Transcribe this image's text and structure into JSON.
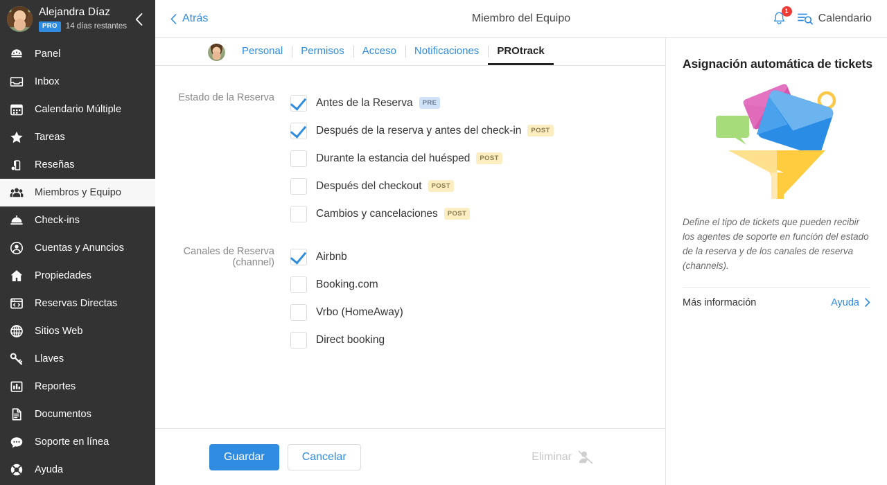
{
  "sidebar": {
    "user": {
      "name": "Alejandra Díaz",
      "plan_badge": "PRO",
      "trial": "14 días restantes"
    },
    "collapse_icon": "chevron-left-icon",
    "items": [
      {
        "label": "Panel",
        "icon": "dashboard-icon",
        "active": false
      },
      {
        "label": "Inbox",
        "icon": "inbox-icon",
        "active": false
      },
      {
        "label": "Calendario Múltiple",
        "icon": "calendar-icon",
        "active": false
      },
      {
        "label": "Tareas",
        "icon": "star-icon",
        "active": false
      },
      {
        "label": "Reseñas",
        "icon": "review-icon",
        "active": false
      },
      {
        "label": "Miembros y Equipo",
        "icon": "users-icon",
        "active": true
      },
      {
        "label": "Check-ins",
        "icon": "bell-service-icon",
        "active": false
      },
      {
        "label": "Cuentas y Anuncios",
        "icon": "account-circle-icon",
        "active": false
      },
      {
        "label": "Propiedades",
        "icon": "home-icon",
        "active": false
      },
      {
        "label": "Reservas Directas",
        "icon": "code-window-icon",
        "active": false
      },
      {
        "label": "Sitios Web",
        "icon": "globe-icon",
        "active": false
      },
      {
        "label": "Llaves",
        "icon": "key-icon",
        "active": false
      },
      {
        "label": "Reportes",
        "icon": "bar-chart-icon",
        "active": false
      },
      {
        "label": "Documentos",
        "icon": "document-icon",
        "active": false
      },
      {
        "label": "Soporte en línea",
        "icon": "chat-icon",
        "active": false
      },
      {
        "label": "Ayuda",
        "icon": "lifebuoy-icon",
        "active": false
      }
    ]
  },
  "topbar": {
    "back_label": "Atrás",
    "title": "Miembro del Equipo",
    "notification_count": "1",
    "calendar_label": "Calendario"
  },
  "tabs": [
    {
      "label": "Personal",
      "active": false
    },
    {
      "label": "Permisos",
      "active": false
    },
    {
      "label": "Acceso",
      "active": false
    },
    {
      "label": "Notificaciones",
      "active": false
    },
    {
      "label": "PROtrack",
      "active": true
    }
  ],
  "form": {
    "groups": [
      {
        "label": "Estado de la Reserva",
        "options": [
          {
            "label": "Antes de la Reserva",
            "checked": true,
            "tag": "PRE",
            "tag_type": "pre"
          },
          {
            "label": "Después de la reserva y antes del check-in",
            "checked": true,
            "tag": "POST",
            "tag_type": "post"
          },
          {
            "label": "Durante la estancia del huésped",
            "checked": false,
            "tag": "POST",
            "tag_type": "post"
          },
          {
            "label": "Después del checkout",
            "checked": false,
            "tag": "POST",
            "tag_type": "post"
          },
          {
            "label": "Cambios y cancelaciones",
            "checked": false,
            "tag": "POST",
            "tag_type": "post"
          }
        ]
      },
      {
        "label": "Canales de Reserva (channel)",
        "options": [
          {
            "label": "Airbnb",
            "checked": true,
            "tag": "",
            "tag_type": ""
          },
          {
            "label": "Booking.com",
            "checked": false,
            "tag": "",
            "tag_type": ""
          },
          {
            "label": "Vrbo (HomeAway)",
            "checked": false,
            "tag": "",
            "tag_type": ""
          },
          {
            "label": "Direct booking",
            "checked": false,
            "tag": "",
            "tag_type": ""
          }
        ]
      }
    ]
  },
  "footer": {
    "save_label": "Guardar",
    "cancel_label": "Cancelar",
    "delete_label": "Eliminar",
    "delete_icon": "user-remove-icon"
  },
  "rightpanel": {
    "title": "Asignación automática de tickets",
    "illustration": "funnel-tickets-illustration",
    "description": "Define el tipo de tickets que pueden recibir los agentes de soporte en función del estado de la reserva y de los canales de reserva (channels).",
    "more_label": "Más información",
    "help_label": "Ayuda"
  },
  "colors": {
    "accent": "#2f8ce0",
    "sidebar_bg": "#333333",
    "badge_red": "#ef3b36",
    "tag_pre_bg": "#cfe2f8",
    "tag_post_bg": "#fdeec2"
  }
}
